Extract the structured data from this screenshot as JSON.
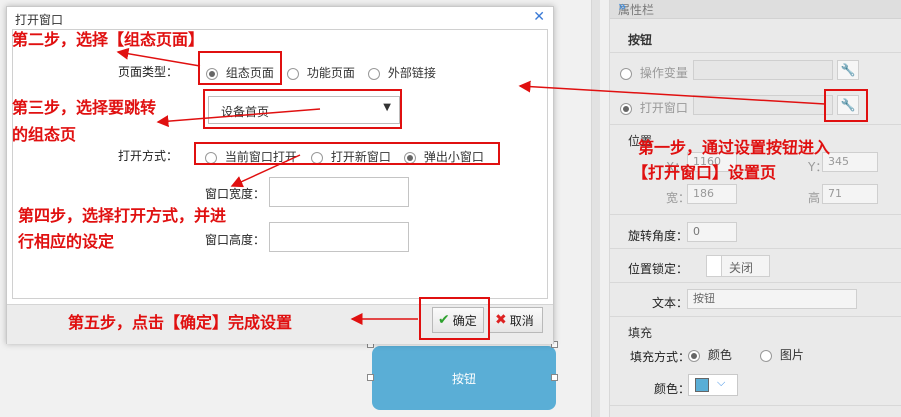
{
  "canvas": {
    "button_label": "按钮"
  },
  "panel": {
    "header_title": "属性栏",
    "section_button": "按钮",
    "opt_variable": "操作变量",
    "opt_open_window": "打开窗口",
    "position_label": "位置",
    "x_label": "X：",
    "x_value": "1160",
    "y_label": "Y：",
    "y_value": "345",
    "width_label": "宽：",
    "width_value": "186",
    "height_label": "高：",
    "height_value": "71",
    "rotation_label": "旋转角度：",
    "rotation_value": "0",
    "lock_label": "位置锁定：",
    "lock_value": "关闭",
    "text_label": "文本：",
    "text_value": "按钮",
    "fill_title": "填充",
    "fill_mode_label": "填充方式：",
    "fill_opt_color": "颜色",
    "fill_opt_image": "图片",
    "color_label": "颜色：",
    "swatch_color": "#5aaed6"
  },
  "dialog": {
    "title": "打开窗口",
    "page_type_label": "页面类型：",
    "page_type_options": [
      "组态页面",
      "功能页面",
      "外部链接"
    ],
    "page_select_value": "设备首页",
    "open_mode_label": "打开方式：",
    "open_mode_options": [
      "当前窗口打开",
      "打开新窗口",
      "弹出小窗口"
    ],
    "window_width_label": "窗口宽度：",
    "window_height_label": "窗口高度：",
    "ok_label": "确定",
    "cancel_label": "取消"
  },
  "annotations": {
    "step1_line1": "第一步，通过设置按钮进入",
    "step1_line2": "【打开窗口】设置页",
    "step2": "第二步，选择【组态页面】",
    "step3_line1": "第三步，选择要跳转",
    "step3_line2": "的组态页",
    "step4_line1": "第四步，选择打开方式，并进",
    "step4_line2": "行相应的设定",
    "step5": "第五步，点击【确定】完成设置"
  }
}
